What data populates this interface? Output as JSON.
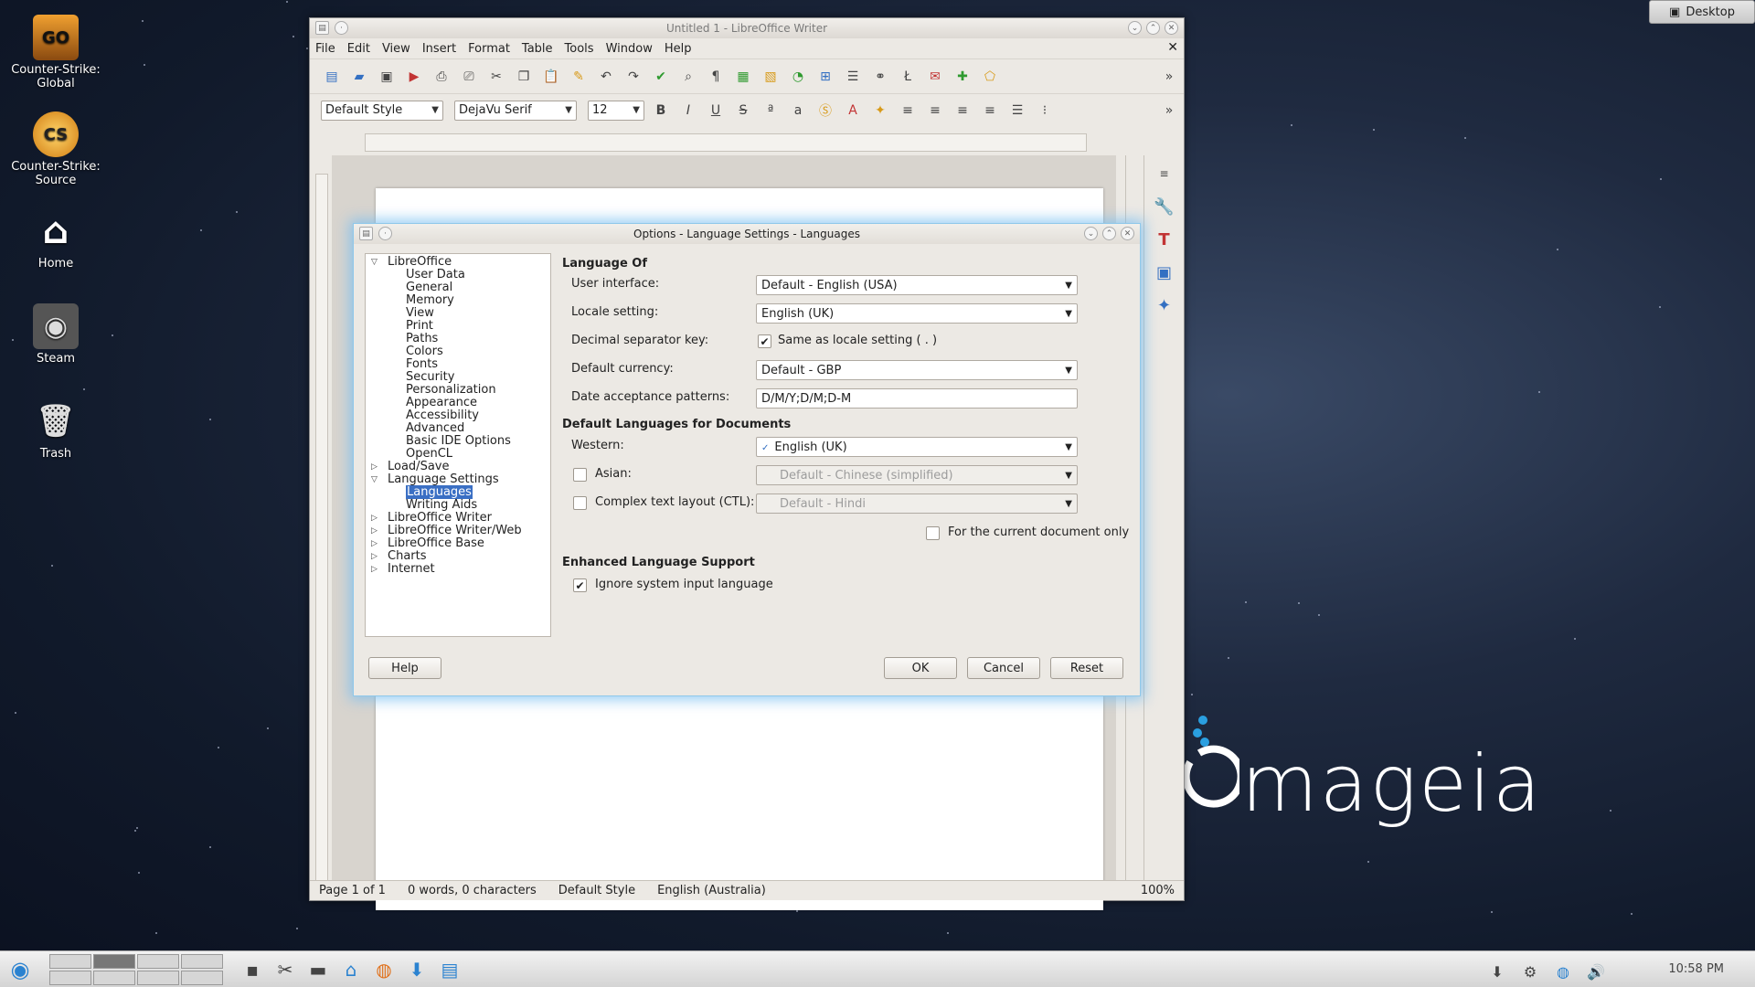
{
  "desktop": {
    "icons": [
      {
        "label": "Counter-Strike: Global",
        "glyph": "GO"
      },
      {
        "label": "Counter-Strike: Source",
        "glyph": "CS"
      },
      {
        "label": "Home",
        "glyph": "⌂"
      },
      {
        "label": "Steam",
        "glyph": "◉"
      },
      {
        "label": "Trash",
        "glyph": "🗑"
      }
    ],
    "desktop_button": "Desktop",
    "logo_text": "mageia"
  },
  "writer": {
    "title": "Untitled 1 - LibreOffice Writer",
    "menu": [
      "File",
      "Edit",
      "View",
      "Insert",
      "Format",
      "Table",
      "Tools",
      "Window",
      "Help"
    ],
    "style_combo": "Default Style",
    "font_combo": "DejaVu Serif",
    "size_combo": "12",
    "status": {
      "page": "Page 1 of 1",
      "words": "0 words, 0 characters",
      "style": "Default Style",
      "language": "English (Australia)",
      "zoom": "100%"
    }
  },
  "dialog": {
    "title": "Options - Language Settings - Languages",
    "tree": {
      "root": "LibreOffice",
      "root_children": [
        "User Data",
        "General",
        "Memory",
        "View",
        "Print",
        "Paths",
        "Colors",
        "Fonts",
        "Security",
        "Personalization",
        "Appearance",
        "Accessibility",
        "Advanced",
        "Basic IDE Options",
        "OpenCL"
      ],
      "load_save": "Load/Save",
      "lang_settings": "Language Settings",
      "lang_children": [
        "Languages",
        "Writing Aids"
      ],
      "others": [
        "LibreOffice Writer",
        "LibreOffice Writer/Web",
        "LibreOffice Base",
        "Charts",
        "Internet"
      ]
    },
    "language_of": {
      "heading": "Language Of",
      "user_interface_label": "User interface:",
      "user_interface_value": "Default - English (USA)",
      "locale_label": "Locale setting:",
      "locale_value": "English (UK)",
      "decimal_label": "Decimal separator key:",
      "decimal_checkbox": "Same as locale setting ( . )",
      "currency_label": "Default currency:",
      "currency_value": "Default - GBP",
      "date_label": "Date acceptance patterns:",
      "date_value": "D/M/Y;D/M;D-M"
    },
    "default_languages": {
      "heading": "Default Languages for Documents",
      "western_label": "Western:",
      "western_value": "English (UK)",
      "asian_label": "Asian:",
      "asian_value": "Default - Chinese (simplified)",
      "ctl_label": "Complex text layout (CTL):",
      "ctl_value": "Default - Hindi",
      "current_doc_label": "For the current document only"
    },
    "enhanced": {
      "heading": "Enhanced Language Support",
      "ignore_label": "Ignore system input language"
    },
    "buttons": {
      "help": "Help",
      "ok": "OK",
      "cancel": "Cancel",
      "reset": "Reset"
    }
  },
  "taskbar": {
    "clock": "10:58 PM"
  }
}
